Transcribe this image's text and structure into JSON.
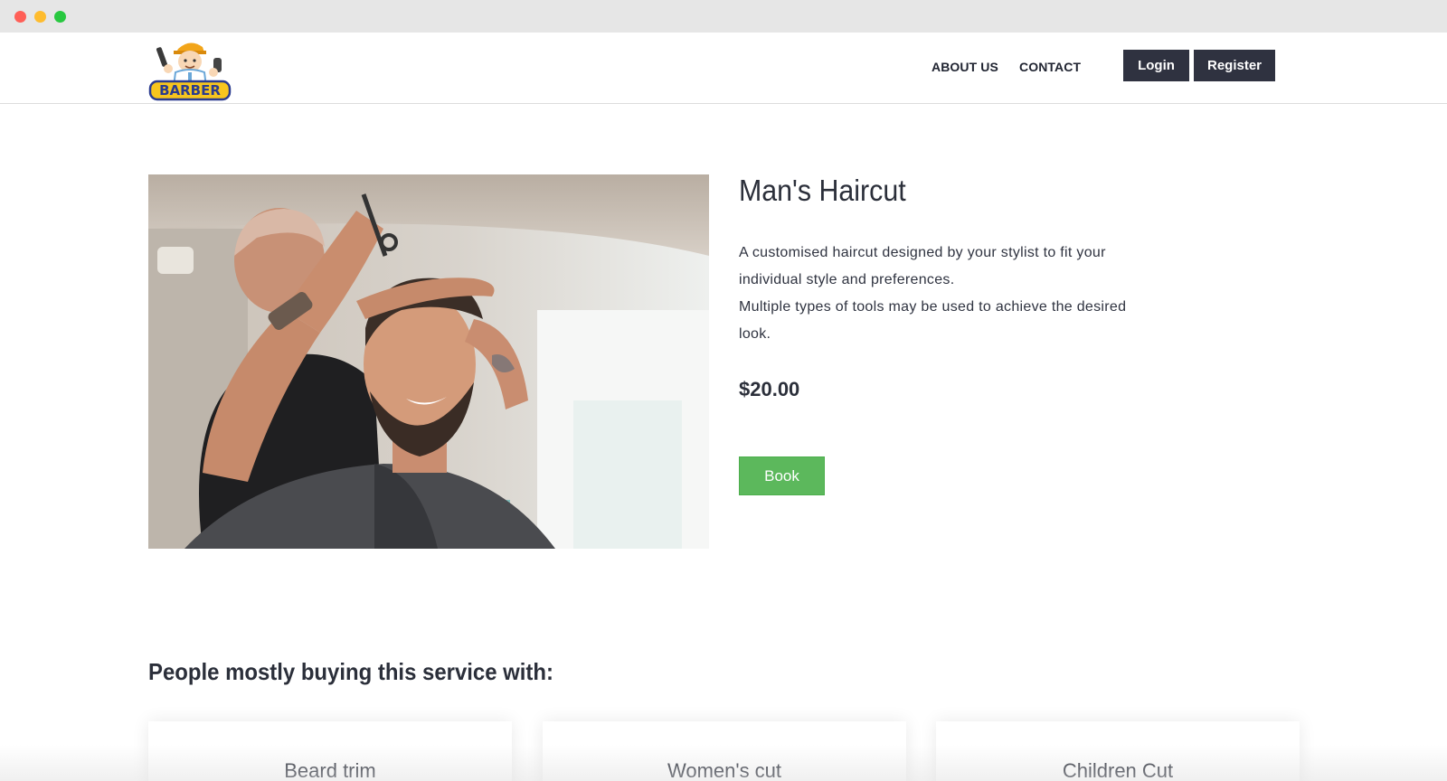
{
  "window": {
    "controls": [
      "close",
      "minimize",
      "zoom"
    ]
  },
  "header": {
    "logo_text": "BARBER",
    "nav": {
      "about_label": "ABOUT US",
      "contact_label": "CONTACT"
    },
    "login_label": "Login",
    "register_label": "Register"
  },
  "product": {
    "title": "Man's Haircut",
    "description_line_1": "A customised haircut designed by your stylist to fit your individual style and preferences.",
    "description_line_2": "Multiple types of tools may be used to achieve the desired look.",
    "price": "$20.00",
    "book_label": "Book"
  },
  "related": {
    "heading": "People mostly buying this service with:",
    "items": [
      {
        "title": "Beard trim"
      },
      {
        "title": "Women's cut"
      },
      {
        "title": "Children Cut"
      }
    ]
  },
  "colors": {
    "dark_button": "#2f3240",
    "book_green": "#5cb85c",
    "text": "#2b2f3a"
  }
}
